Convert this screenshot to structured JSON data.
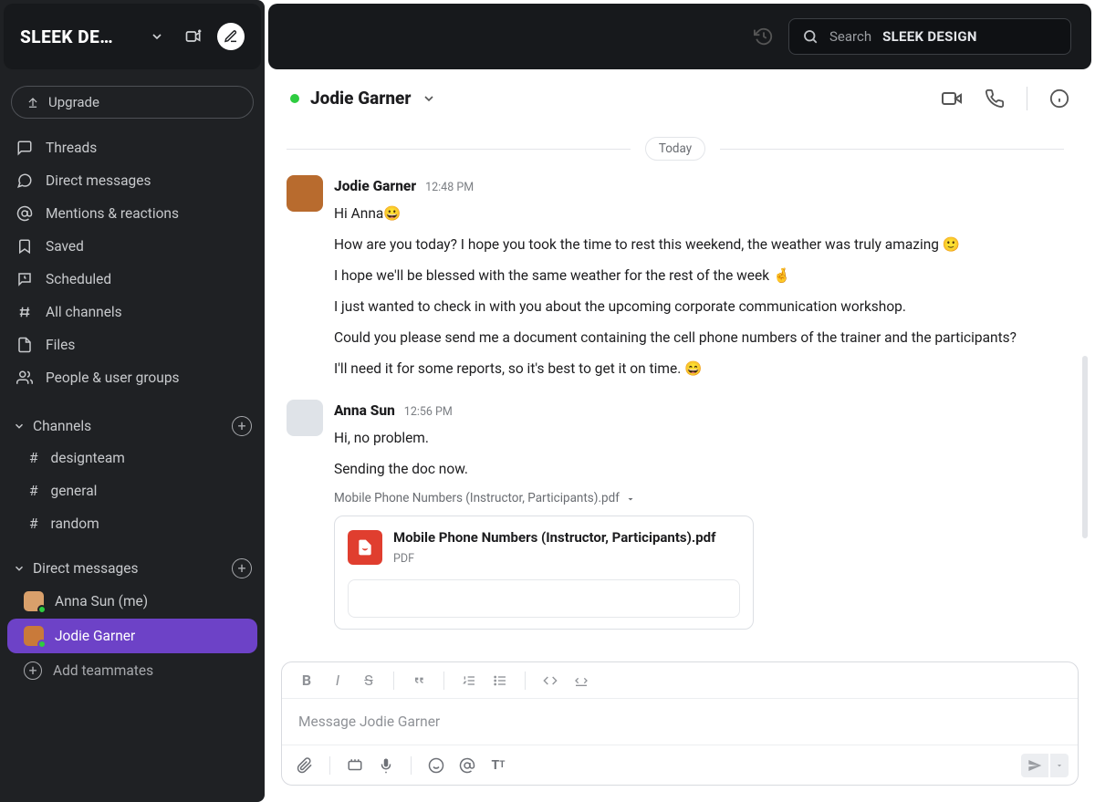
{
  "workspace": {
    "name": "SLEEK DE…"
  },
  "upgrade_label": "Upgrade",
  "search": {
    "label": "Search",
    "workspace": "SLEEK DESIGN"
  },
  "nav": {
    "threads": "Threads",
    "dms": "Direct messages",
    "mentions": "Mentions & reactions",
    "saved": "Saved",
    "scheduled": "Scheduled",
    "all_channels": "All channels",
    "files": "Files",
    "people": "People & user groups"
  },
  "sections": {
    "channels_title": "Channels",
    "channels": [
      "designteam",
      "general",
      "random"
    ],
    "dms_title": "Direct messages",
    "dms": [
      {
        "name": "Anna Sun (me)",
        "color": "#d9a06b"
      },
      {
        "name": "Jodie Garner",
        "color": "#c97a3a",
        "active": true
      }
    ],
    "add_teammates": "Add teammates"
  },
  "conversation": {
    "title": "Jodie Garner",
    "date_label": "Today",
    "messages": [
      {
        "author": "Jodie Garner",
        "time": "12:48 PM",
        "avatar_color": "#b86b2e",
        "lines": [
          "Hi Anna😀",
          "How are you today? I hope you took the time to rest this weekend, the weather was truly amazing 🙂",
          "I hope we'll be blessed with the same weather for the rest of the week 🤞",
          "I just wanted to check in with you about the upcoming corporate communication workshop.",
          "Could you please send me a document containing the cell phone numbers of the trainer and the participants?",
          "I'll need it for some reports, so it's best to get it on time. 😄"
        ]
      },
      {
        "author": "Anna Sun",
        "time": "12:56 PM",
        "avatar_color": "#dfe3e8",
        "lines": [
          "Hi, no problem.",
          "Sending the doc now."
        ],
        "attachment": {
          "label": "Mobile Phone Numbers (Instructor, Participants).pdf",
          "filename": "Mobile Phone Numbers (Instructor, Participants).pdf",
          "filetype": "PDF"
        }
      }
    ]
  },
  "composer": {
    "placeholder": "Message Jodie Garner"
  }
}
